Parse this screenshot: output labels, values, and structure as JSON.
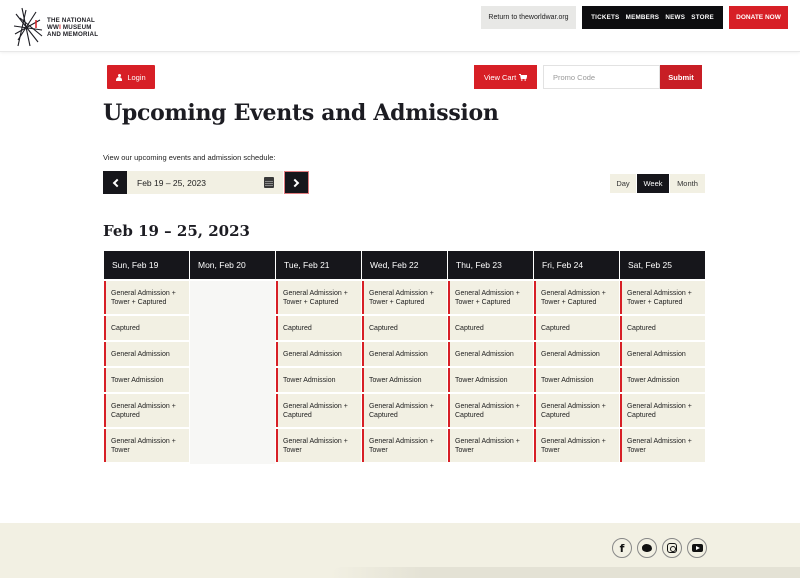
{
  "header": {
    "logo": {
      "line1": "THE NATIONAL",
      "line2_prefix": "WW",
      "line2_red": "I",
      "line2_suffix": " MUSEUM",
      "line3": "AND MEMORIAL"
    },
    "return_link": "Return to theworldwar.org",
    "nav": [
      "TICKETS",
      "MEMBERS",
      "NEWS",
      "STORE"
    ],
    "donate": "DONATE NOW"
  },
  "actions": {
    "login": "Login",
    "view_cart": "View Cart",
    "promo_placeholder": "Promo Code",
    "submit": "Submit"
  },
  "page": {
    "title": "Upcoming Events and Admission",
    "subtitle": "View our upcoming events and admission schedule:",
    "date_range": "Feb 19 – 25, 2023",
    "week_title": "Feb 19 – 25, 2023"
  },
  "view_toggle": {
    "options": [
      "Day",
      "Week",
      "Month"
    ],
    "selected": "Week"
  },
  "calendar": {
    "days": [
      {
        "label": "Sun, Feb 19",
        "events": [
          "General Admission + Tower + Captured",
          "Captured",
          "General Admission",
          "Tower Admission",
          "General Admission + Captured",
          "General Admission + Tower"
        ]
      },
      {
        "label": "Mon, Feb 20",
        "events": []
      },
      {
        "label": "Tue, Feb 21",
        "events": [
          "General Admission + Tower + Captured",
          "Captured",
          "General Admission",
          "Tower Admission",
          "General Admission + Captured",
          "General Admission + Tower"
        ]
      },
      {
        "label": "Wed, Feb 22",
        "events": [
          "General Admission + Tower + Captured",
          "Captured",
          "General Admission",
          "Tower Admission",
          "General Admission + Captured",
          "General Admission + Tower"
        ]
      },
      {
        "label": "Thu, Feb 23",
        "events": [
          "General Admission + Tower + Captured",
          "Captured",
          "General Admission",
          "Tower Admission",
          "General Admission + Captured",
          "General Admission + Tower"
        ]
      },
      {
        "label": "Fri, Feb 24",
        "events": [
          "General Admission + Tower + Captured",
          "Captured",
          "General Admission",
          "Tower Admission",
          "General Admission + Captured",
          "General Admission + Tower"
        ]
      },
      {
        "label": "Sat, Feb 25",
        "events": [
          "General Admission + Tower + Captured",
          "Captured",
          "General Admission",
          "Tower Admission",
          "General Admission + Captured",
          "General Admission + Tower"
        ]
      }
    ]
  },
  "footer": {
    "social": [
      "facebook",
      "twitter",
      "instagram",
      "youtube"
    ]
  },
  "colors": {
    "brand_red": "#d71f26",
    "dark": "#16161b",
    "cream": "#f2f0e3"
  }
}
